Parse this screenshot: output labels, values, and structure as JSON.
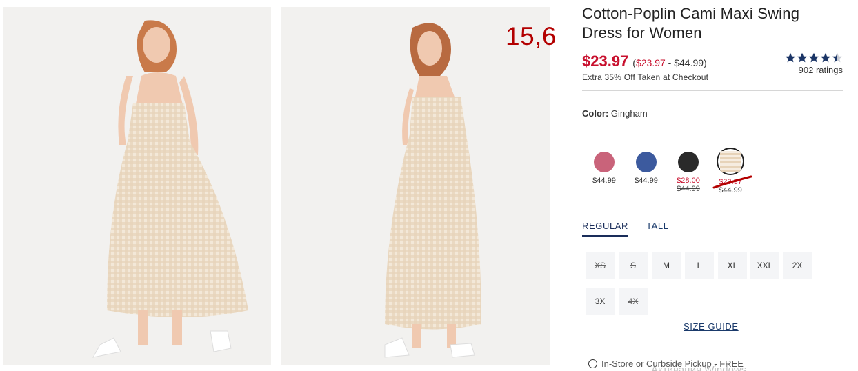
{
  "product": {
    "title": "Cotton-Poplin Cami Maxi Swing Dress for Women",
    "sale_price": "$23.97",
    "range_open": "(",
    "range_low": "$23.97",
    "range_rest": " - $44.99)",
    "promo": "Extra 35% Off Taken at Checkout",
    "rating_value": 4.5,
    "ratings_link": "902 ratings"
  },
  "annotation": {
    "text": "15,6"
  },
  "color": {
    "label": "Color:",
    "value": "Gingham",
    "swatches": [
      {
        "name": "pink",
        "hex": "#c9637a",
        "price": "$44.99",
        "was": ""
      },
      {
        "name": "blue",
        "hex": "#3c5a9e",
        "price": "$44.99",
        "was": ""
      },
      {
        "name": "black",
        "hex": "#2a2a2a",
        "price": "$28.00",
        "was": "$44.99"
      },
      {
        "name": "gingham",
        "hex": "#ead9c2",
        "price": "$23.97",
        "was": "$44.99"
      }
    ]
  },
  "fit_tabs": [
    "REGULAR",
    "TALL"
  ],
  "sizes": [
    {
      "label": "XS",
      "available": false
    },
    {
      "label": "S",
      "available": false
    },
    {
      "label": "M",
      "available": true
    },
    {
      "label": "L",
      "available": true
    },
    {
      "label": "XL",
      "available": true
    },
    {
      "label": "XXL",
      "available": true
    },
    {
      "label": "2X",
      "available": true
    },
    {
      "label": "3X",
      "available": true
    },
    {
      "label": "4X",
      "available": false
    }
  ],
  "size_guide": "SIZE GUIDE",
  "pickup": "In-Store or Curbside Pickup - FREE",
  "watermark": "Активация Windows",
  "colors": {
    "sale_red": "#c8102e",
    "navy": "#1a2d5a",
    "star": "#1b3566"
  }
}
